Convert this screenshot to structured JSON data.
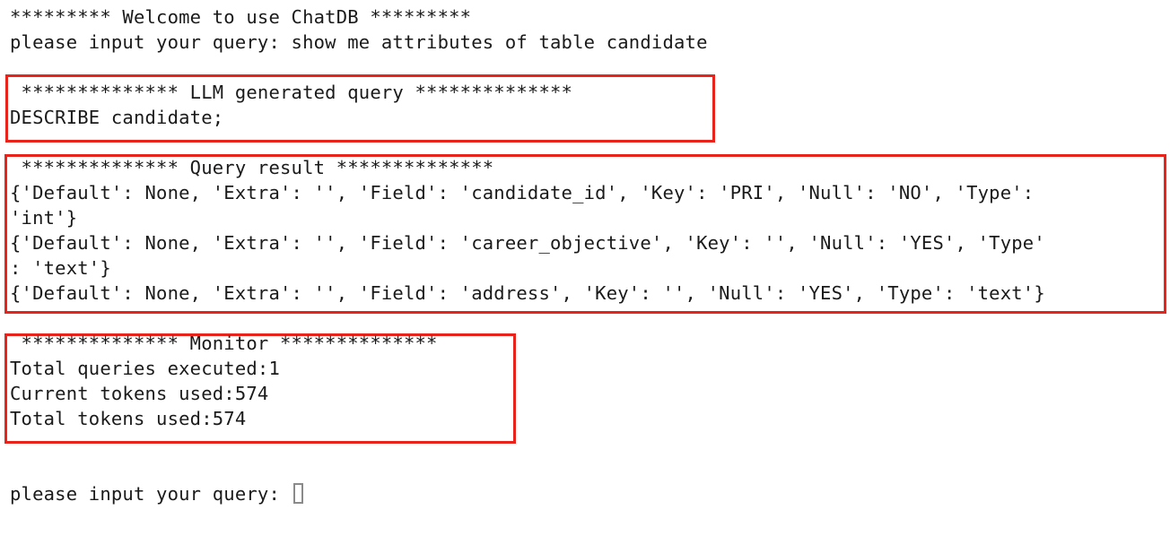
{
  "terminal": {
    "top_partial_line": "*",
    "welcome": "********* Welcome to use ChatDB *********",
    "first_prompt": "please input your query: show me attributes of table candidate",
    "llm_section": {
      "header": " ************** LLM generated query **************",
      "query": "DESCRIBE candidate;"
    },
    "result_section": {
      "header": " ************** Query result **************",
      "lines": [
        "{'Default': None, 'Extra': '', 'Field': 'candidate_id', 'Key': 'PRI', 'Null': 'NO', 'Type':",
        "'int'}",
        "{'Default': None, 'Extra': '', 'Field': 'career_objective', 'Key': '', 'Null': 'YES', 'Type'",
        ": 'text'}",
        "{'Default': None, 'Extra': '', 'Field': 'address', 'Key': '', 'Null': 'YES', 'Type': 'text'}"
      ]
    },
    "monitor_section": {
      "header": " ************** Monitor **************",
      "lines": [
        "Total queries executed:1",
        "Current tokens used:574",
        "Total tokens used:574"
      ]
    },
    "next_prompt": "please input your query: "
  },
  "colors": {
    "highlight_box": "#e8231c",
    "text": "#1a1a1a",
    "cursor": "#8a8a8a",
    "background": "#ffffff"
  }
}
